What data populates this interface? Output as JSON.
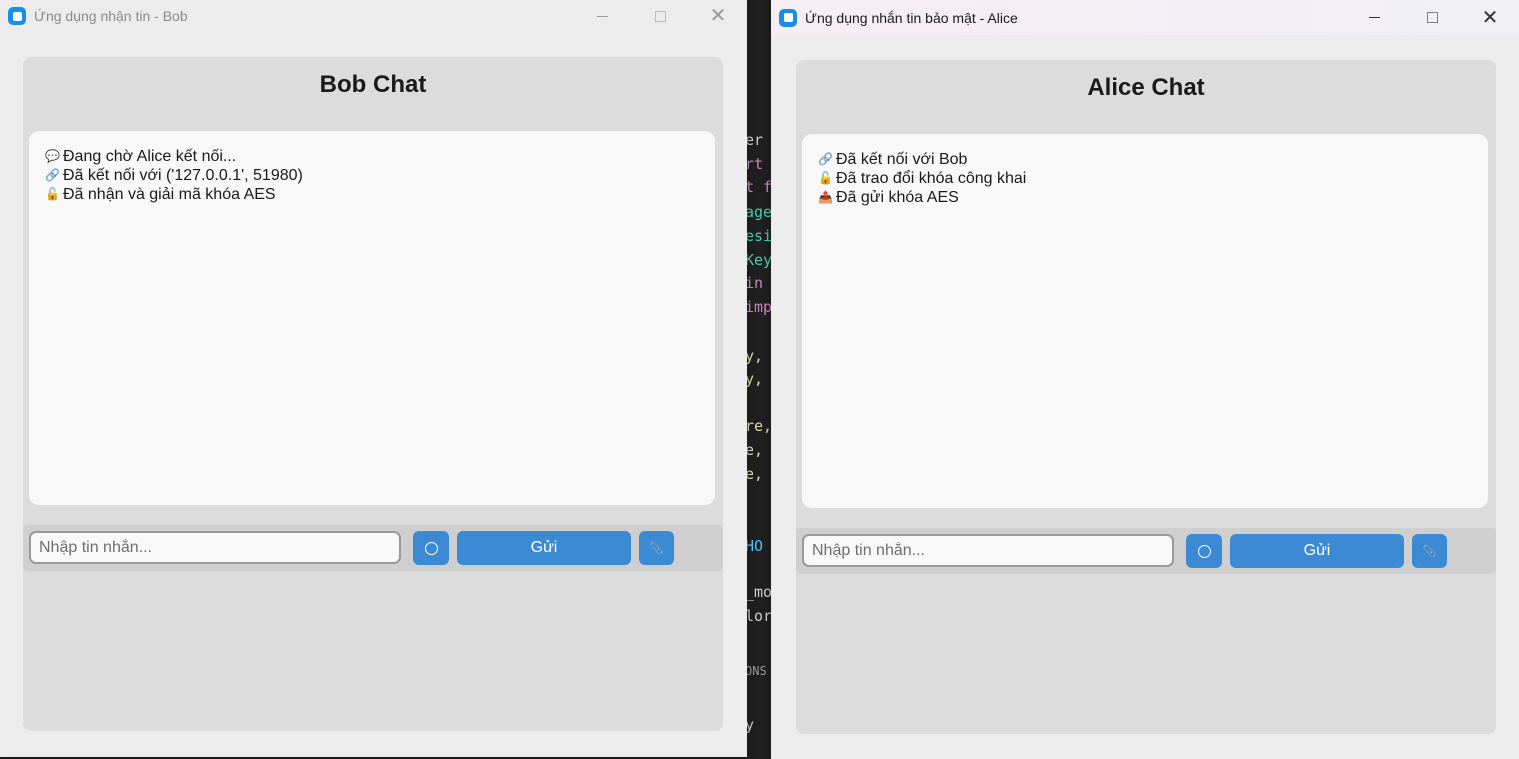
{
  "bob_window": {
    "title": "Ứng dụng nhận tin - Bob",
    "chat_title": "Bob Chat",
    "messages": [
      {
        "icon": "speech-bubble-icon",
        "glyph": "💬",
        "text": "Đang chờ Alice kết nối..."
      },
      {
        "icon": "link-icon",
        "glyph": "🔗",
        "text": "Đã kết nối với ('127.0.0.1', 51980)"
      },
      {
        "icon": "unlock-icon",
        "glyph": "🔓",
        "text": "Đã nhận và giải mã khóa AES"
      }
    ],
    "input_placeholder": "Nhập tin nhắn...",
    "send_label": "Gửi",
    "emoji_button_icon": "smiley-icon",
    "file_button_icon": "paperclip-icon"
  },
  "alice_window": {
    "title": "Ứng dụng nhắn tin bảo mật - Alice",
    "chat_title": "Alice Chat",
    "messages": [
      {
        "icon": "link-icon",
        "glyph": "🔗",
        "text": "Đã kết nối với Bob"
      },
      {
        "icon": "unlock-icon",
        "glyph": "🔓",
        "text": "Đã trao đổi khóa công khai"
      },
      {
        "icon": "outbox-icon",
        "glyph": "📤",
        "text": "Đã gửi khóa AES"
      }
    ],
    "input_placeholder": "Nhập tin nhắn...",
    "send_label": "Gửi",
    "emoji_button_icon": "smiley-icon",
    "file_button_icon": "paperclip-icon"
  },
  "background_editor": {
    "fragments": [
      {
        "text": "er",
        "color": "#cccccc"
      },
      {
        "text": "rt",
        "color": "#c586c0"
      },
      {
        "text": "t f",
        "color": "#c586c0"
      },
      {
        "text": "age",
        "color": "#4ec9b0"
      },
      {
        "text": "esi",
        "color": "#4ec9b0"
      },
      {
        "text": "Key",
        "color": "#4ec9b0"
      },
      {
        "text": " in",
        "color": "#c586c0"
      },
      {
        "text": "imp",
        "color": "#c586c0"
      },
      {
        "text": "y,",
        "color": "#dcdcaa"
      },
      {
        "text": "y,",
        "color": "#dcdcaa"
      },
      {
        "text": "re,",
        "color": "#dcdcaa"
      },
      {
        "text": "e,",
        "color": "#dcdcaa"
      },
      {
        "text": "e,",
        "color": "#dcdcaa"
      },
      {
        "text": "HO",
        "color": "#4fc1ff"
      },
      {
        "text": "_mo",
        "color": "#cccccc"
      },
      {
        "text": "lor",
        "color": "#cccccc"
      },
      {
        "text": "ONS",
        "color": "#999999"
      },
      {
        "text": "y",
        "color": "#cccccc"
      }
    ]
  }
}
